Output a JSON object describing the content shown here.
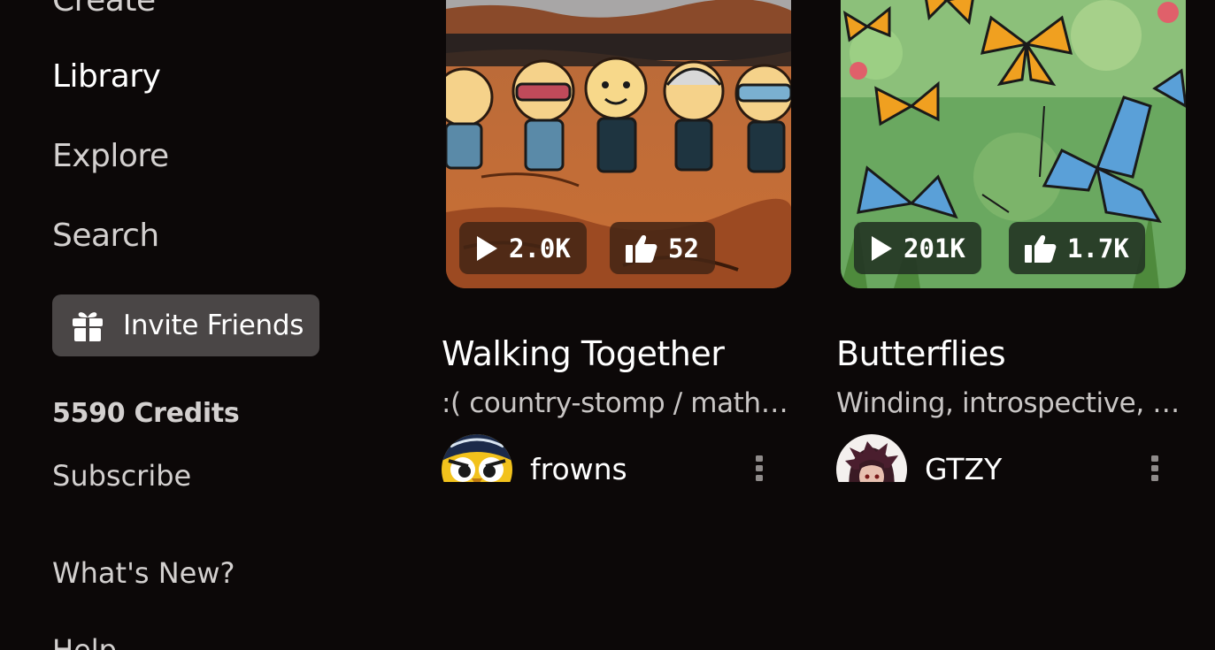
{
  "sidebar": {
    "create_label": "Create",
    "library_label": "Library",
    "explore_label": "Explore",
    "search_label": "Search",
    "invite_label": "Invite Friends",
    "credits": "5590 Credits",
    "subscribe_label": "Subscribe",
    "whats_new_label": "What's New?",
    "help_label": "Help"
  },
  "cards": [
    {
      "title": "Walking Together",
      "description": ":( country-stomp / math-r...",
      "plays": "2.0K",
      "likes": "52",
      "author": "frowns",
      "thumbnail_icon": "cartoon-people-holding-hands",
      "avatar_icon": "owl-avatar"
    },
    {
      "title": "Butterflies",
      "description": "Winding, introspective, m...",
      "plays": "201K",
      "likes": "1.7K",
      "author": "GTZY",
      "thumbnail_icon": "butterflies-artwork",
      "avatar_icon": "anime-character-avatar"
    }
  ],
  "colors": {
    "background": "#0c0808",
    "invite_button": "#4a4646",
    "text_primary": "#ffffff",
    "text_secondary": "#d3d0cf"
  }
}
